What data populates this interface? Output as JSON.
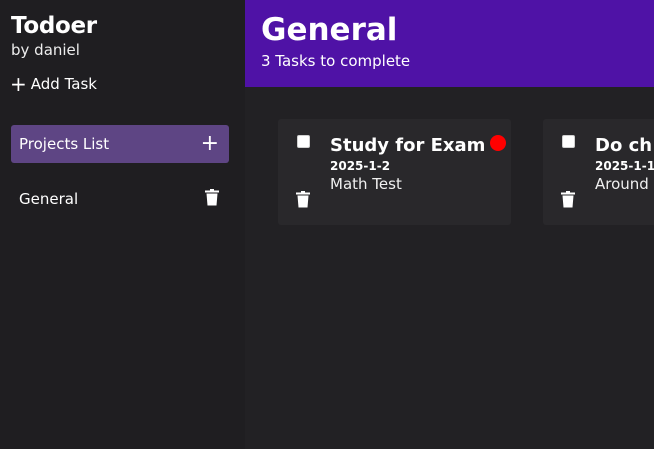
{
  "sidebar": {
    "app_name": "Todoer",
    "author": "by daniel",
    "add_task_label": "Add Task",
    "projects_header": "Projects List",
    "projects": [
      {
        "label": "General"
      }
    ]
  },
  "header": {
    "title": "General",
    "subtitle": "3 Tasks to complete",
    "color": "#4f12a6"
  },
  "tasks": [
    {
      "title": "Study for Exam",
      "date": "2025-1-2",
      "description": "Math Test",
      "priority_color": "#ff0000",
      "checked": false
    },
    {
      "title": "Do ch",
      "date": "2025-1-1",
      "description": "Around",
      "checked": false
    }
  ],
  "colors": {
    "accent": "#5e4584",
    "sidebar_bg": "#1f1e21",
    "main_bg": "#222124",
    "card_bg": "#29282b"
  }
}
